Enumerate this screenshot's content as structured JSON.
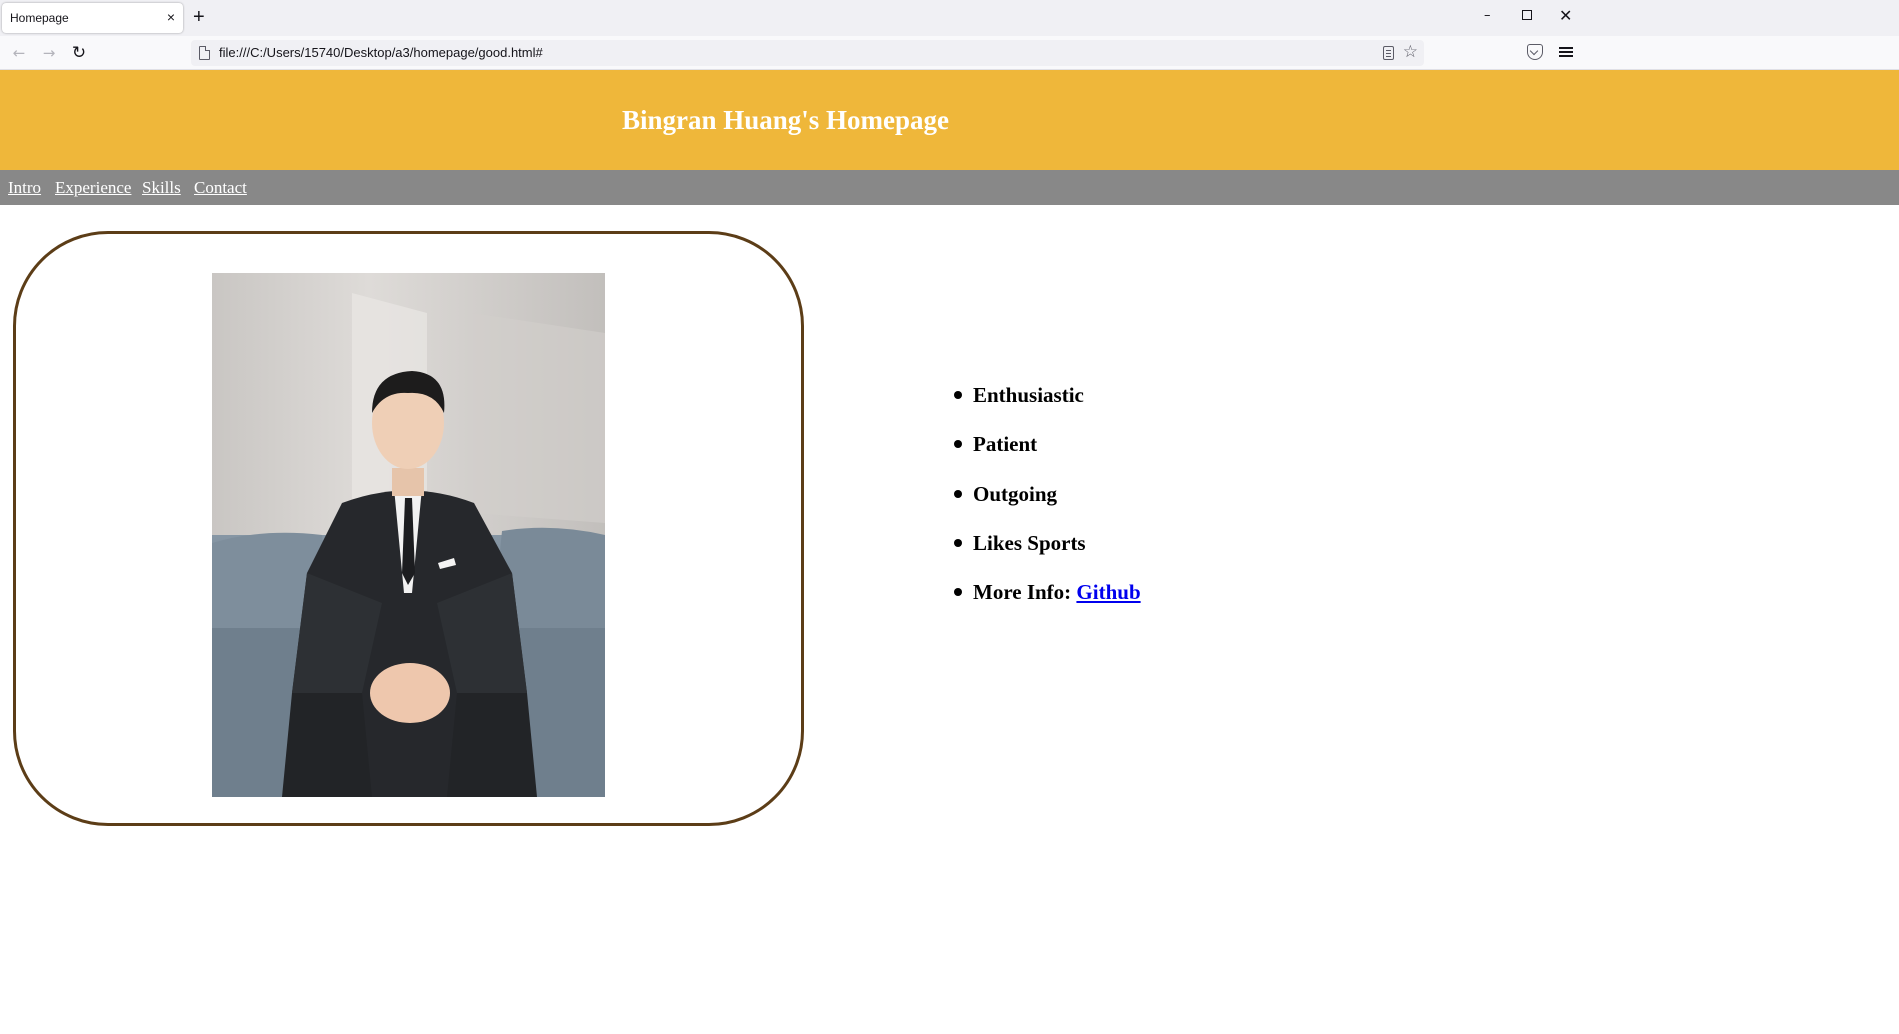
{
  "browser": {
    "tab_title": "Homepage",
    "tab_close": "×",
    "new_tab": "+",
    "url": "file:///C:/Users/15740/Desktop/a3/homepage/good.html#",
    "icons": [
      "back-icon",
      "forward-icon",
      "reload-icon",
      "page-icon",
      "reader-view-icon",
      "bookmark-star-icon",
      "pocket-icon",
      "menu-icon",
      "minimize-icon",
      "restore-icon",
      "close-window-icon"
    ]
  },
  "header": {
    "title": "Bingran Huang's Homepage",
    "bg_color": "#efb73a"
  },
  "nav": {
    "bg_color": "#888888",
    "items": [
      {
        "label": "Intro"
      },
      {
        "label": "Experience"
      },
      {
        "label": "Skills"
      },
      {
        "label": "Contact"
      }
    ]
  },
  "profile": {
    "frame_color": "#5c3d17",
    "traits": [
      "Enthusiastic",
      "Patient",
      "Outgoing",
      "Likes Sports"
    ],
    "more_info_label": "More Info:",
    "more_info_link": "Github"
  }
}
